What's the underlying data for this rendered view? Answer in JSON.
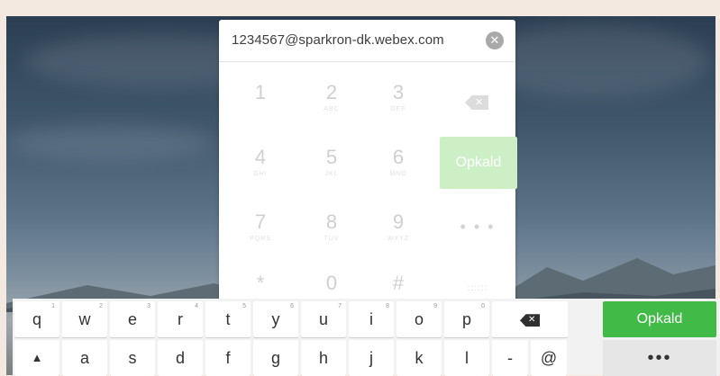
{
  "dialpad": {
    "address_value": "1234567@sparkron-dk.webex.com",
    "clear_icon": "✕",
    "keys": [
      {
        "digit": "1",
        "sub": ""
      },
      {
        "digit": "2",
        "sub": "ABC"
      },
      {
        "digit": "3",
        "sub": "DEF"
      },
      {
        "digit": "4",
        "sub": "GHI"
      },
      {
        "digit": "5",
        "sub": "JKL"
      },
      {
        "digit": "6",
        "sub": "MNO"
      },
      {
        "digit": "7",
        "sub": "PQRS"
      },
      {
        "digit": "8",
        "sub": "TUV"
      },
      {
        "digit": "9",
        "sub": "WXYZ"
      },
      {
        "digit": "*",
        "sub": ""
      },
      {
        "digit": "0",
        "sub": ""
      },
      {
        "digit": "#",
        "sub": ""
      }
    ],
    "call_label": "Opkald",
    "more_label": "• • •",
    "keyboard_toggle_label": "::::::"
  },
  "keyboard": {
    "row1": [
      {
        "key": "q",
        "num": "1"
      },
      {
        "key": "w",
        "num": "2"
      },
      {
        "key": "e",
        "num": "3"
      },
      {
        "key": "r",
        "num": "4"
      },
      {
        "key": "t",
        "num": "5"
      },
      {
        "key": "y",
        "num": "6"
      },
      {
        "key": "u",
        "num": "7"
      },
      {
        "key": "i",
        "num": "8"
      },
      {
        "key": "o",
        "num": "9"
      },
      {
        "key": "p",
        "num": "0"
      }
    ],
    "row2": [
      "▲",
      "a",
      "s",
      "d",
      "f",
      "g",
      "h",
      "j",
      "k",
      "l",
      "-",
      "@"
    ],
    "backspace_icon": "✕",
    "call_label": "Opkald",
    "more_label": "•••"
  },
  "colors": {
    "call_green": "#41ba47",
    "call_green_disabled": "#ccefc6"
  }
}
